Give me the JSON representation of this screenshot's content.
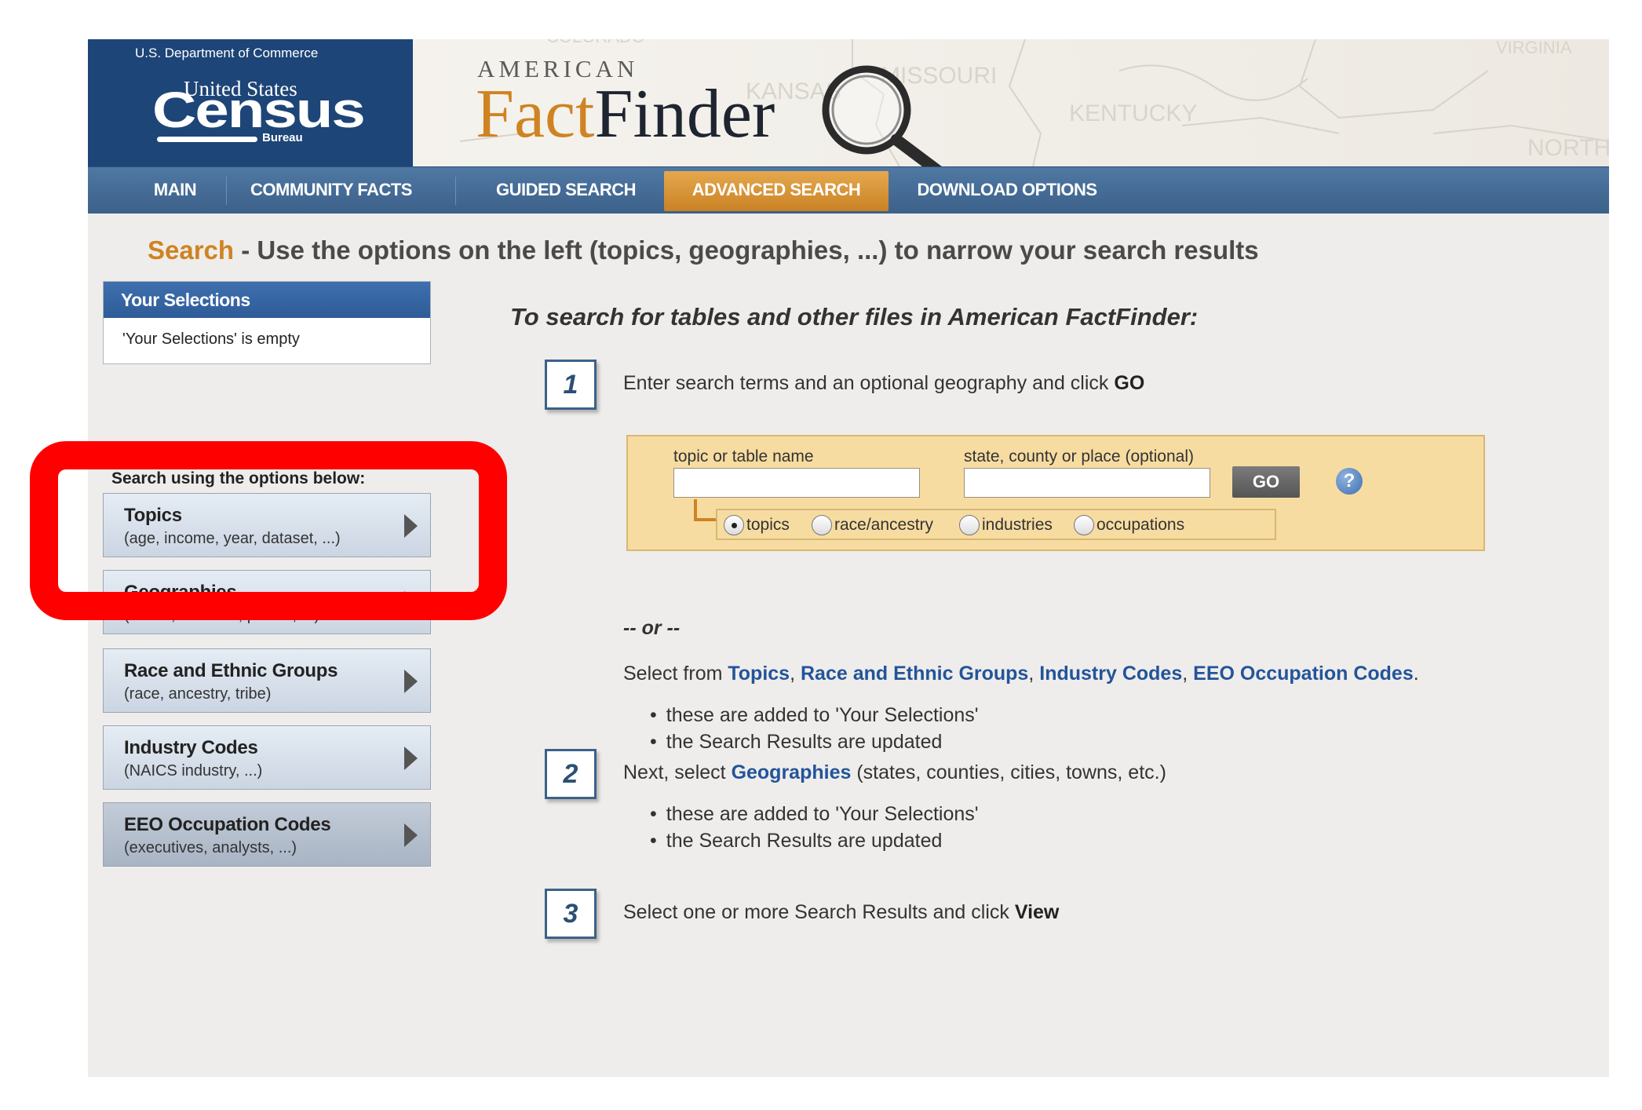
{
  "banner": {
    "department": "U.S. Department of Commerce",
    "census_top": "United States",
    "census_word": "Census",
    "census_bureau": "Bureau",
    "map_states": [
      "MISSOURI",
      "KANSAS",
      "KENTUCKY",
      "VIRGINIA",
      "NORTH",
      "COLORADO"
    ],
    "product_small": "AMERICAN",
    "product_fact": "Fact",
    "product_finder": "Finder"
  },
  "nav": {
    "items": [
      {
        "label": "MAIN"
      },
      {
        "label": "COMMUNITY FACTS"
      },
      {
        "label": "GUIDED SEARCH"
      },
      {
        "label": "ADVANCED SEARCH",
        "active": true
      },
      {
        "label": "DOWNLOAD OPTIONS"
      }
    ]
  },
  "headline": {
    "keyword": "Search",
    "text": " - Use the options on the left (topics, geographies, ...) to narrow your search results"
  },
  "selections": {
    "title": "Your Selections",
    "empty_text": "'Your Selections' is empty"
  },
  "options": {
    "label": "Search using the options below:",
    "items": [
      {
        "title": "Topics",
        "subtitle": "(age, income, year, dataset, ...)"
      },
      {
        "title": "Geographies",
        "subtitle": "(states, counties, places, ...)"
      },
      {
        "title": "Race and Ethnic Groups",
        "subtitle": "(race, ancestry, tribe)"
      },
      {
        "title": "Industry Codes",
        "subtitle": "(NAICS industry, ...)"
      },
      {
        "title": "EEO Occupation Codes",
        "subtitle": "(executives, analysts, ...)"
      }
    ]
  },
  "main": {
    "title": "To search for tables and other files in American FactFinder:",
    "step1": {
      "number": "1",
      "text": "Enter search terms and an optional geography and click ",
      "bold": "GO"
    },
    "search_panel": {
      "topic_label": "topic or table name",
      "topic_value": "",
      "geo_label": "state, county or place (optional)",
      "geo_value": "",
      "go_label": "GO",
      "help_glyph": "?",
      "radios": [
        {
          "label": "topics",
          "checked": true
        },
        {
          "label": "race/ancestry",
          "checked": false
        },
        {
          "label": "industries",
          "checked": false
        },
        {
          "label": "occupations",
          "checked": false
        }
      ]
    },
    "or_text": "-- or --",
    "select_from": {
      "prefix": "Select from ",
      "links": [
        "Topics",
        "Race and Ethnic Groups",
        "Industry Codes",
        "EEO Occupation Codes"
      ],
      "sep": ", ",
      "suffix": "."
    },
    "bullets1": [
      "these are added to 'Your Selections'",
      "the Search Results are updated"
    ],
    "step2": {
      "number": "2",
      "prefix": "Next, select ",
      "link": "Geographies",
      "suffix": " (states, counties, cities, towns, etc.)"
    },
    "bullets2": [
      "these are added to 'Your Selections'",
      "the Search Results are updated"
    ],
    "step3": {
      "number": "3",
      "text": "Select one or more Search Results and click ",
      "bold": "View"
    }
  },
  "colors": {
    "nav": "#4f78a3",
    "accent_orange": "#cf8322",
    "census_blue": "#1d4577",
    "highlight_red": "#ff0000",
    "link_blue": "#23549a"
  }
}
